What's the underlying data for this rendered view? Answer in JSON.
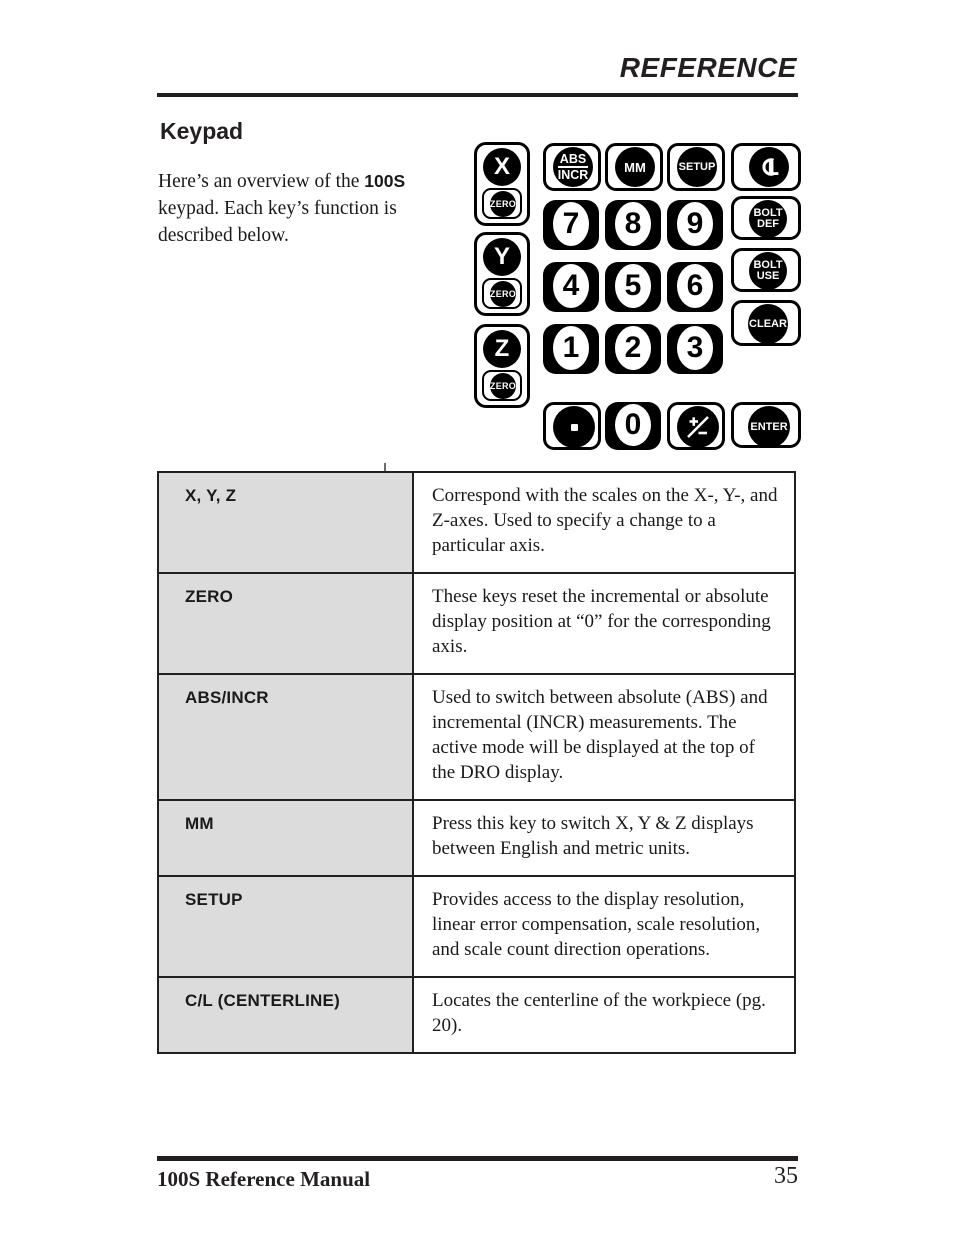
{
  "header": {
    "section_label": "REFERENCE"
  },
  "page": {
    "title": "Keypad",
    "intro_before": "Here’s an overview of the ",
    "intro_bold": "100S",
    "intro_after": " keypad. Each key’s function is described below."
  },
  "keypad": {
    "axis_keys": [
      {
        "label": "X",
        "zero_label": "ZERO"
      },
      {
        "label": "Y",
        "zero_label": "ZERO"
      },
      {
        "label": "Z",
        "zero_label": "ZERO"
      }
    ],
    "function_keys": {
      "abs_top": "ABS",
      "abs_bottom": "INCR",
      "mm": "MM",
      "setup": "SETUP",
      "centerline": "C/L",
      "bolt_def_top": "BOLT",
      "bolt_def_bottom": "DEF",
      "bolt_use_top": "BOLT",
      "bolt_use_bottom": "USE",
      "clear": "CLEAR",
      "enter": "ENTER"
    },
    "numeric_keys": [
      "7",
      "8",
      "9",
      "4",
      "5",
      "6",
      "1",
      "2",
      "3"
    ],
    "bottom_keys": {
      "decimal": ".",
      "zero": "0",
      "plus_minus": "+/-"
    }
  },
  "table": {
    "rows": [
      {
        "key": "X, Y, Z",
        "desc": "Correspond with the scales on the X-, Y-, and Z-axes. Used to specify a change to a particular axis."
      },
      {
        "key": "ZERO",
        "desc": "These keys reset the incremental or absolute display position at “0” for the corresponding axis."
      },
      {
        "key": "ABS/INCR",
        "desc": "Used to switch between absolute (ABS) and incremental (INCR) measurements. The active mode will be displayed at the top of the DRO display."
      },
      {
        "key": "MM",
        "desc": "Press this key to switch X, Y & Z displays between English and metric units."
      },
      {
        "key": "SETUP",
        "desc": "Provides access to the display resolution, linear error compensation, scale resolution, and scale count direction operations."
      },
      {
        "key": "C/L (CENTERLINE)",
        "desc": "Locates the centerline of the workpiece (pg. 20)."
      }
    ]
  },
  "footer": {
    "manual_title": "100S Reference Manual",
    "page_number": "35"
  }
}
